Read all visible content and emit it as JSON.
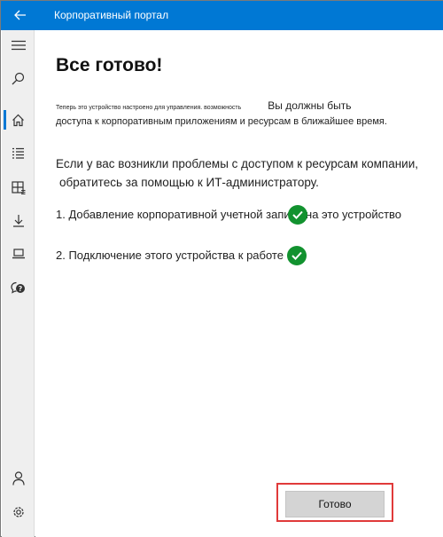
{
  "window": {
    "app_title": "Корпоративный портал"
  },
  "sidebar": {
    "items": [
      {
        "icon": "hamburger-menu-icon"
      },
      {
        "icon": "search-icon"
      },
      {
        "icon": "home-icon",
        "active": true
      },
      {
        "icon": "apps-list-icon"
      },
      {
        "icon": "app-categories-icon"
      },
      {
        "icon": "download-icon"
      },
      {
        "icon": "devices-laptop-icon"
      },
      {
        "icon": "help-support-icon"
      },
      {
        "icon": "account-person-icon"
      },
      {
        "icon": "settings-gear-icon"
      }
    ]
  },
  "main": {
    "title": "Все готово!",
    "intro_small": "Теперь это устройство настроено для управления. возможность",
    "intro_big": "Вы должны быть",
    "intro_line2": "доступа к корпоративным приложениям и ресурсам в ближайшее время.",
    "help_line1": "Если у вас возникли проблемы с доступом к ресурсам компании,",
    "help_line2": "обратитесь за помощью к ИТ-администратору.",
    "steps": [
      {
        "label": "1. Добавление корпоративной учетной записи на это устройство",
        "status": "complete"
      },
      {
        "label": "2. Подключение этого устройства к работе",
        "status": "complete"
      }
    ],
    "done_button": "Готово"
  },
  "colors": {
    "titlebar": "#0078d4",
    "success": "#12922f",
    "highlight": "#e03a3a",
    "button": "#d4d4d4"
  }
}
